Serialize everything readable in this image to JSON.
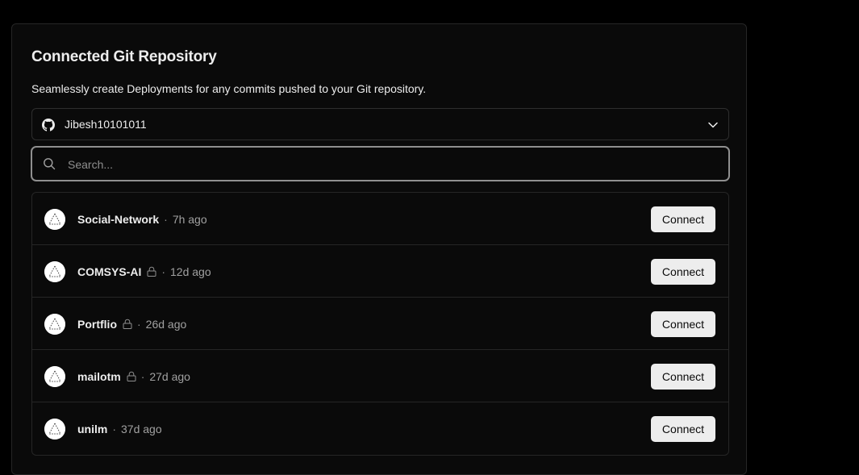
{
  "section": {
    "title": "Connected Git Repository",
    "description": "Seamlessly create Deployments for any commits pushed to your Git repository."
  },
  "account": {
    "name": "Jibesh10101011",
    "icon": "github-icon"
  },
  "search": {
    "placeholder": "Search...",
    "value": ""
  },
  "repositories": [
    {
      "name": "Social-Network",
      "private": false,
      "separator": "·",
      "time": "7h ago",
      "action": "Connect"
    },
    {
      "name": "COMSYS-AI",
      "private": true,
      "separator": "·",
      "time": "12d ago",
      "action": "Connect"
    },
    {
      "name": "Portflio",
      "private": true,
      "separator": "·",
      "time": "26d ago",
      "action": "Connect"
    },
    {
      "name": "mailotm",
      "private": true,
      "separator": "·",
      "time": "27d ago",
      "action": "Connect"
    },
    {
      "name": "unilm",
      "private": false,
      "separator": "·",
      "time": "37d ago",
      "action": "Connect"
    }
  ],
  "colors": {
    "background": "#000000",
    "card": "#0a0a0a",
    "border": "#262626",
    "text": "#ededed",
    "muted": "#a1a1a1",
    "button": "#ededed"
  }
}
